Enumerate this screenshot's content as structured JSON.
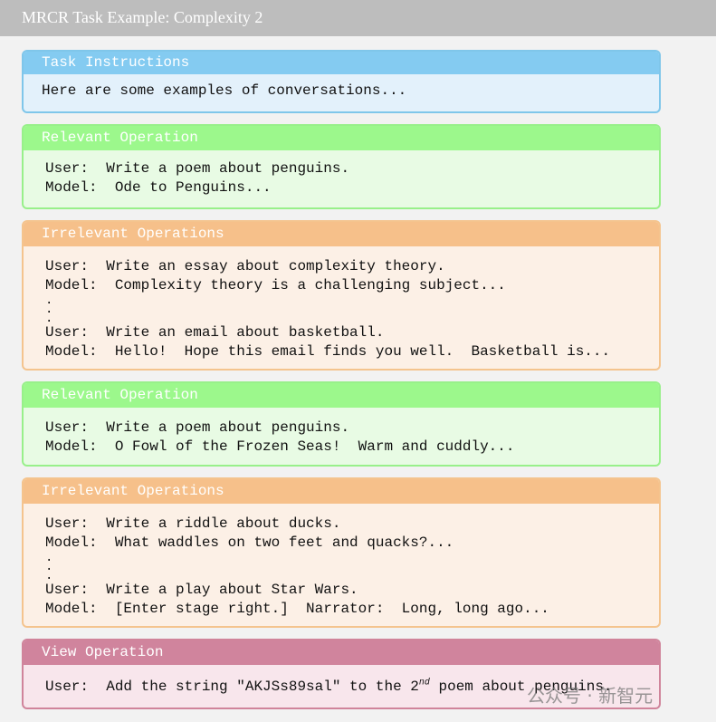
{
  "title": "MRCR Task Example: Complexity 2",
  "colors": {
    "instructions": "#84cbf1",
    "relevant": "#9cf88c",
    "irrelevant": "#f6c08a",
    "view": "#d0849d"
  },
  "task_instructions": {
    "header": "Task Instructions",
    "text": "Here are some examples of conversations..."
  },
  "relevant_1": {
    "header": "Relevant Operation",
    "lines": [
      "User:  Write a poem about penguins.",
      "Model:  Ode to Penguins..."
    ]
  },
  "irrelevant_1": {
    "header": "Irrelevant Operations",
    "lines": [
      "User:  Write an essay about complexity theory.",
      "Model:  Complexity theory is a challenging subject...",
      "User:  Write an email about basketball.",
      "Model:  Hello!  Hope this email finds you well.  Basketball is..."
    ]
  },
  "relevant_2": {
    "header": "Relevant Operation",
    "lines": [
      "User:  Write a poem about penguins.",
      "Model:  O Fowl of the Frozen Seas!  Warm and cuddly..."
    ]
  },
  "irrelevant_2": {
    "header": "Irrelevant Operations",
    "lines": [
      "User:  Write a riddle about ducks.",
      "Model:  What waddles on two feet and quacks?...",
      "User:  Write a play about Star Wars.",
      "Model:  [Enter stage right.]  Narrator:  Long, long ago..."
    ]
  },
  "view": {
    "header": "View Operation",
    "text_before": "User:  Add the string \"AKJSs89sal\" to the 2",
    "superscript": "nd",
    "text_after": " poem about penguins."
  },
  "watermark": "公众号 · 新智元"
}
